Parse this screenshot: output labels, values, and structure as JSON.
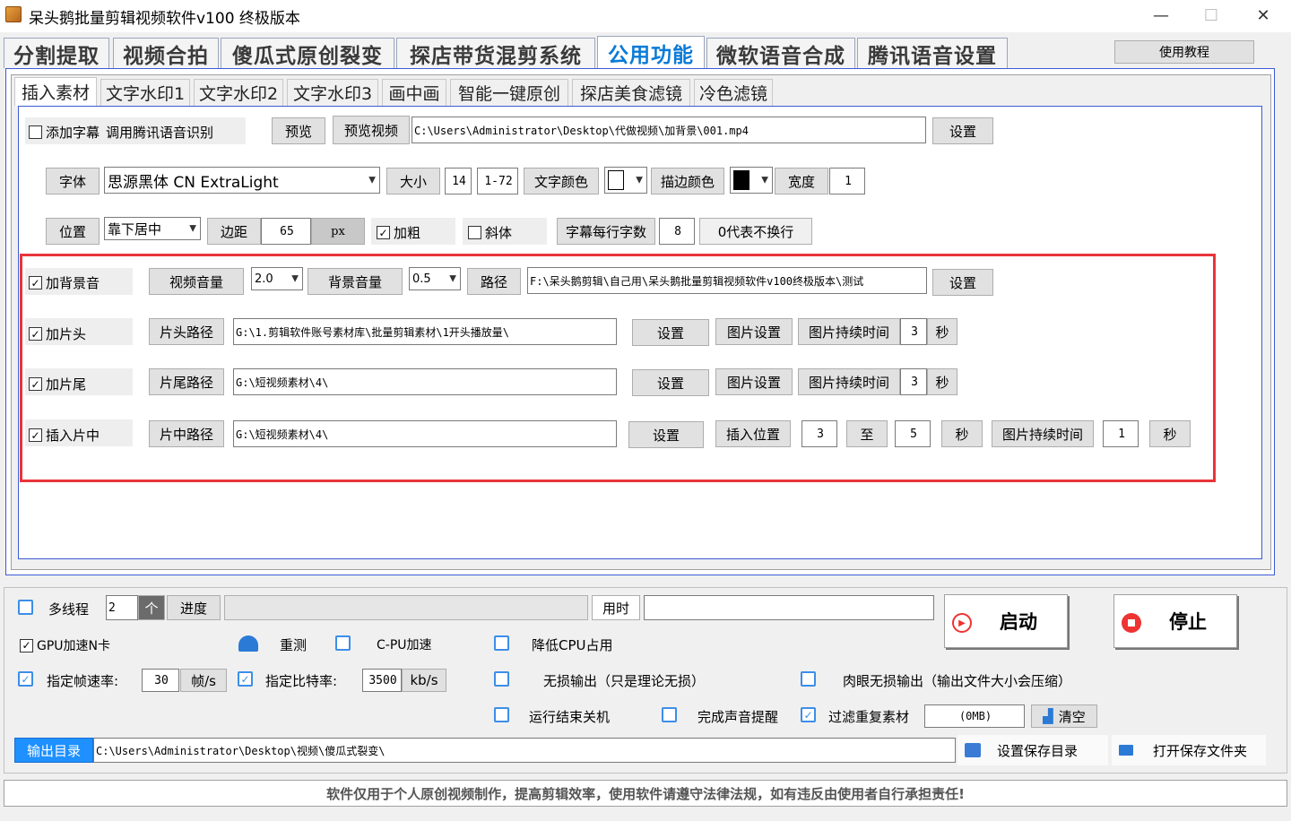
{
  "window": {
    "title": "呆头鹅批量剪辑视频软件v100 终极版本",
    "minimize": "—",
    "maximize": "☐",
    "close": "✕"
  },
  "main_tabs": [
    "分割提取",
    "视频合拍",
    "傻瓜式原创裂变",
    "探店带货混剪系统",
    "公用功能",
    "微软语音合成",
    "腾讯语音设置"
  ],
  "tutorial_button": "使用教程",
  "sub_tabs": [
    "插入素材",
    "文字水印1",
    "文字水印2",
    "文字水印3",
    "画中画",
    "智能一键原创",
    "探店美食滤镜",
    "冷色滤镜"
  ],
  "subtitle": {
    "label": "添加字幕",
    "note": "调用腾讯语音识别",
    "preview": "预览",
    "preview_video": "预览视频",
    "path": "C:\\Users\\Administrator\\Desktop\\代做视频\\加背景\\001.mp4",
    "settings": "设置"
  },
  "font_row": {
    "font_btn": "字体",
    "font_value": "思源黑体 CN ExtraLight",
    "size_btn": "大小",
    "size_value": "14",
    "size_range": "1-72",
    "text_color": "文字颜色",
    "stroke_color": "描边颜色",
    "width_btn": "宽度",
    "width_value": "1",
    "text_swatch": "#ffffff",
    "stroke_swatch": "#000000"
  },
  "position_row": {
    "pos_btn": "位置",
    "pos_value": "靠下居中",
    "margin_btn": "边距",
    "margin_value": "65",
    "unit": "px",
    "bold": "加粗",
    "italic": "斜体",
    "chars_btn": "字幕每行字数",
    "chars_value": "8",
    "no_wrap": "0代表不换行"
  },
  "bgm_row": {
    "label": "加背景音",
    "video_vol": "视频音量",
    "video_vol_value": "2.0",
    "bg_vol": "背景音量",
    "bg_vol_value": "0.5",
    "path_btn": "路径",
    "path": "F:\\呆头鹅剪辑\\自己用\\呆头鹅批量剪辑视频软件v100终极版本\\测试",
    "settings": "设置"
  },
  "head_row": {
    "label": "加片头",
    "path_btn": "片头路径",
    "path": "G:\\1.剪辑软件账号素材库\\批量剪辑素材\\1开头播放量\\",
    "settings": "设置",
    "img_settings": "图片设置",
    "img_duration": "图片持续时间",
    "duration_value": "3",
    "sec": "秒"
  },
  "tail_row": {
    "label": "加片尾",
    "path_btn": "片尾路径",
    "path": "G:\\短视频素材\\4\\",
    "settings": "设置",
    "img_settings": "图片设置",
    "img_duration": "图片持续时间",
    "duration_value": "3",
    "sec": "秒"
  },
  "insert_row": {
    "label": "插入片中",
    "path_btn": "片中路径",
    "path": "G:\\短视频素材\\4\\",
    "settings": "设置",
    "insert_pos": "插入位置",
    "from_value": "3",
    "to": "至",
    "to_value": "5",
    "sec": "秒",
    "img_duration": "图片持续时间",
    "duration_value": "1",
    "sec2": "秒"
  },
  "bottom": {
    "multithread": "多线程",
    "threads": "2",
    "unit": "个",
    "progress": "进度",
    "elapsed": "用时",
    "elapsed_value": "",
    "start": "启动",
    "stop": "停止",
    "gpu": "GPU加速N卡",
    "retest": "重测",
    "cpu_accel": "C-PU加速",
    "lower_cpu": "降低CPU占用",
    "fps_label": "指定帧速率:",
    "fps_value": "30",
    "fps_unit": "帧/s",
    "bitrate_label": "指定比特率:",
    "bitrate_value": "3500",
    "bitrate_unit": "kb/s",
    "lossless": "无损输出（只是理论无损）",
    "visual_lossless": "肉眼无损输出（输出文件大小会压缩）",
    "shutdown": "运行结束关机",
    "sound": "完成声音提醒",
    "filter_dup": "过滤重复素材",
    "cache_value": "(0MB)",
    "clear": "清空",
    "output_btn": "输出目录",
    "output_path": "C:\\Users\\Administrator\\Desktop\\视频\\傻瓜式裂变\\",
    "set_dir": "设置保存目录",
    "open_dir": "打开保存文件夹"
  },
  "footer": "软件仅用于个人原创视频制作，提高剪辑效率，使用软件请遵守法律法规，如有违反由使用者自行承担责任!",
  "colors": {
    "accent": "#0a7ad6",
    "highlight": "#e8343a",
    "panel_border": "#3c5bd6"
  }
}
